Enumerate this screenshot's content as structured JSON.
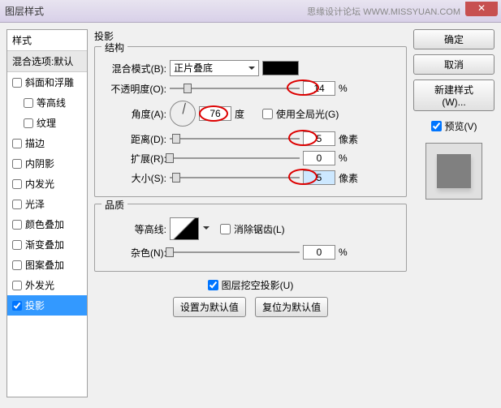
{
  "window": {
    "title": "图层样式",
    "watermark": "思缘设计论坛 WWW.MISSYUAN.COM"
  },
  "styles": {
    "header": "样式",
    "blend_default": "混合选项:默认",
    "items": [
      {
        "label": "斜面和浮雕",
        "checked": false,
        "indent": false
      },
      {
        "label": "等高线",
        "checked": false,
        "indent": true
      },
      {
        "label": "纹理",
        "checked": false,
        "indent": true
      },
      {
        "label": "描边",
        "checked": false,
        "indent": false
      },
      {
        "label": "内阴影",
        "checked": false,
        "indent": false
      },
      {
        "label": "内发光",
        "checked": false,
        "indent": false
      },
      {
        "label": "光泽",
        "checked": false,
        "indent": false
      },
      {
        "label": "颜色叠加",
        "checked": false,
        "indent": false
      },
      {
        "label": "渐变叠加",
        "checked": false,
        "indent": false
      },
      {
        "label": "图案叠加",
        "checked": false,
        "indent": false
      },
      {
        "label": "外发光",
        "checked": false,
        "indent": false
      },
      {
        "label": "投影",
        "checked": true,
        "indent": false,
        "selected": true
      }
    ]
  },
  "dropshadow": {
    "title": "投影",
    "structure_title": "结构",
    "blend_mode_label": "混合模式(B):",
    "blend_mode_value": "正片叠底",
    "opacity_label": "不透明度(O):",
    "opacity_value": "14",
    "opacity_unit": "%",
    "angle_label": "角度(A):",
    "angle_value": "76",
    "angle_unit": "度",
    "global_light_label": "使用全局光(G)",
    "distance_label": "距离(D):",
    "distance_value": "5",
    "distance_unit": "像素",
    "spread_label": "扩展(R):",
    "spread_value": "0",
    "spread_unit": "%",
    "size_label": "大小(S):",
    "size_value": "5",
    "size_unit": "像素",
    "quality_title": "品质",
    "contour_label": "等高线:",
    "antialias_label": "消除锯齿(L)",
    "noise_label": "杂色(N):",
    "noise_value": "0",
    "noise_unit": "%",
    "knockout_label": "图层挖空投影(U)",
    "set_default": "设置为默认值",
    "reset_default": "复位为默认值"
  },
  "buttons": {
    "ok": "确定",
    "cancel": "取消",
    "new_style": "新建样式(W)...",
    "preview": "预览(V)"
  }
}
